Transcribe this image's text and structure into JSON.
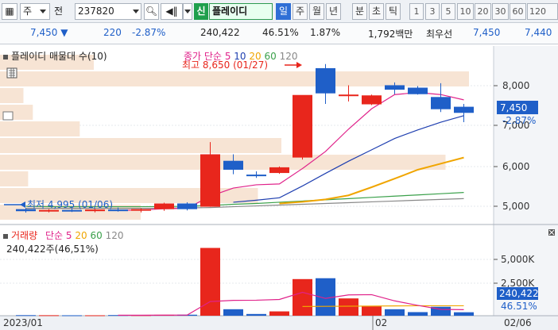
{
  "toolbar": {
    "market": "주",
    "market_prefix": "전",
    "stock_code": "237820",
    "sin_label": "신",
    "stock_name": "플레이디",
    "periods": [
      "일",
      "주",
      "월",
      "년",
      "분",
      "초",
      "틱"
    ],
    "active_period": "일",
    "intervals": [
      "1",
      "3",
      "5",
      "10",
      "20",
      "30",
      "60",
      "120"
    ]
  },
  "quote": {
    "price": "7,450",
    "change": "220",
    "change_pct": "-2.87%",
    "volume": "240,422",
    "volume_ratio": "46.51%",
    "turnover": "1.87%",
    "amount": "1,792백만",
    "priority_label": "최우선",
    "ask": "7,450",
    "bid": "7,440"
  },
  "price_panel": {
    "title": "플레이디 매물대 수(10)",
    "ma_label": "종가 단순",
    "ma_periods": [
      "5",
      "10",
      "20",
      "60",
      "120"
    ],
    "ma_colors": [
      "#e0228a",
      "#1f3fb0",
      "#f0a500",
      "#3aa04a",
      "#888888"
    ],
    "high_note": "최고 8,650 (01/27)",
    "low_note": "최저 4,995 (01/06)",
    "current_price_label": "7,450",
    "current_change_label": "-2.87%",
    "y_ticks": [
      "8,000",
      "7,000",
      "6,000",
      "5,000"
    ]
  },
  "volume_panel": {
    "title": "거래량",
    "ma_label": "단순",
    "ma_periods": [
      "5",
      "20",
      "60",
      "120"
    ],
    "volume_text": "240,422주(46,51%)",
    "current_volume_label": "240,422",
    "current_ratio_label": "46.51%",
    "y_ticks": [
      "5,000K",
      "2,500K"
    ]
  },
  "x_axis": {
    "labels": [
      "2023/01",
      "02"
    ],
    "right_label": "02/06"
  },
  "colors": {
    "up": "#e8261c",
    "down": "#1f5fc8",
    "volume_profile": "#f7e4d4",
    "accent_blue": "#2f6fd6",
    "accent_green": "#1f9f4c"
  },
  "chart_data": {
    "type": "candlestick",
    "y_unit": "KRW",
    "ylim": [
      4800,
      8900
    ],
    "candles": [
      {
        "o": 5080,
        "h": 5110,
        "l": 4995,
        "c": 5030
      },
      {
        "o": 5030,
        "h": 5080,
        "l": 5000,
        "c": 5060
      },
      {
        "o": 5060,
        "h": 5100,
        "l": 5010,
        "c": 5040
      },
      {
        "o": 5040,
        "h": 5090,
        "l": 5000,
        "c": 5070
      },
      {
        "o": 5070,
        "h": 5120,
        "l": 5020,
        "c": 5050
      },
      {
        "o": 5050,
        "h": 5100,
        "l": 5000,
        "c": 5080
      },
      {
        "o": 5080,
        "h": 5240,
        "l": 5040,
        "c": 5220
      },
      {
        "o": 5220,
        "h": 5250,
        "l": 5050,
        "c": 5080
      },
      {
        "o": 5140,
        "h": 6730,
        "l": 5140,
        "c": 6430
      },
      {
        "o": 6270,
        "h": 6430,
        "l": 5940,
        "c": 6050
      },
      {
        "o": 5930,
        "h": 6010,
        "l": 5850,
        "c": 5910
      },
      {
        "o": 5970,
        "h": 6130,
        "l": 5950,
        "c": 6110
      },
      {
        "o": 6350,
        "h": 7840,
        "l": 6300,
        "c": 7890
      },
      {
        "o": 8550,
        "h": 8650,
        "l": 7670,
        "c": 7930
      },
      {
        "o": 7890,
        "h": 8130,
        "l": 7730,
        "c": 7900
      },
      {
        "o": 7660,
        "h": 7900,
        "l": 7640,
        "c": 7880
      },
      {
        "o": 8130,
        "h": 8200,
        "l": 7910,
        "c": 8020
      },
      {
        "o": 8070,
        "h": 8110,
        "l": 7900,
        "c": 7910
      },
      {
        "o": 7840,
        "h": 8180,
        "l": 7470,
        "c": 7540
      },
      {
        "o": 7600,
        "h": 7670,
        "l": 7220,
        "c": 7450
      }
    ],
    "volume": [
      40,
      35,
      30,
      30,
      45,
      40,
      60,
      70,
      4700,
      450,
      120,
      300,
      2540,
      2600,
      1200,
      650,
      450,
      250,
      620,
      240
    ],
    "vol_ylim": [
      0,
      5500
    ],
    "ma5": [
      null,
      null,
      null,
      null,
      5050,
      5060,
      5090,
      5100,
      5400,
      5600,
      5680,
      5700,
      6080,
      6500,
      7050,
      7550,
      7900,
      7950,
      7900,
      7770
    ],
    "ma10": [
      null,
      null,
      null,
      null,
      null,
      null,
      null,
      null,
      null,
      5250,
      5300,
      5360,
      5650,
      5960,
      6260,
      6540,
      6820,
      7030,
      7220,
      7380
    ],
    "ma20": [
      null,
      null,
      null,
      null,
      null,
      null,
      null,
      null,
      null,
      null,
      null,
      5220,
      5260,
      5320,
      5420,
      5620,
      5830,
      6050,
      6200,
      6350
    ],
    "ma60": [
      5150,
      5140,
      5140,
      5140,
      5140,
      5140,
      5145,
      5150,
      5170,
      5200,
      5220,
      5250,
      5280,
      5310,
      5340,
      5370,
      5400,
      5430,
      5460,
      5490
    ],
    "ma120": [
      5100,
      5100,
      5100,
      5100,
      5100,
      5100,
      5105,
      5110,
      5120,
      5140,
      5160,
      5180,
      5200,
      5220,
      5240,
      5260,
      5280,
      5300,
      5320,
      5340
    ],
    "vol_ma5": [
      null,
      null,
      null,
      null,
      36,
      36,
      41,
      49,
      983,
      1064,
      1076,
      1128,
      1622,
      1202,
      1442,
      1462,
      1030,
      720,
      440,
      420
    ],
    "vol_ma20": [
      null,
      null,
      null,
      null,
      null,
      null,
      null,
      null,
      null,
      null,
      null,
      null,
      640,
      650,
      660,
      670,
      680,
      690,
      690,
      690
    ],
    "volume_profile": [
      0.3,
      0.55,
      0.06,
      0.95,
      0.6,
      0.17,
      0.07,
      0.05,
      1.0,
      0.2
    ],
    "x_labels": [
      "2023/01",
      "02"
    ]
  }
}
